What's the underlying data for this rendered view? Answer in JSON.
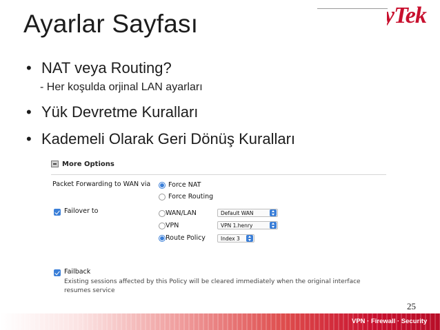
{
  "slide": {
    "title": "Ayarlar Sayfası",
    "logo_text": "yTek",
    "bullets": [
      {
        "bullet": "•",
        "text": "NAT veya Routing?"
      },
      {
        "bullet": "•",
        "text": "Yük Devretme Kuralları"
      },
      {
        "bullet": "•",
        "text": "Kademeli Olarak Geri Dönüş Kuralları"
      }
    ],
    "sub_item": "- Her koşulda orjinal LAN ayarları",
    "page_number": "25",
    "footer_tagline": "VPN · Firewall · Security"
  },
  "panel": {
    "header": "More Options",
    "packet_forwarding_label": "Packet Forwarding to WAN via",
    "forwarding_options": [
      {
        "label": "Force NAT",
        "selected": true
      },
      {
        "label": "Force Routing",
        "selected": false
      }
    ],
    "failover": {
      "label": "Failover to",
      "checked": true,
      "options": [
        {
          "label": "WAN/LAN",
          "selected": false,
          "select_value": "Default WAN"
        },
        {
          "label": "VPN",
          "selected": false,
          "select_value": "VPN 1.henry"
        },
        {
          "label": "Route Policy",
          "selected": true,
          "select_value": "Index 3"
        }
      ]
    },
    "failback": {
      "label": "Failback",
      "checked": true,
      "description_line1": "Existing sessions affected by this Policy will be cleared immediately when the original interface",
      "description_line2": "resumes service"
    }
  },
  "colors": {
    "accent": "#3b7fd8",
    "brand": "#c8102e"
  }
}
